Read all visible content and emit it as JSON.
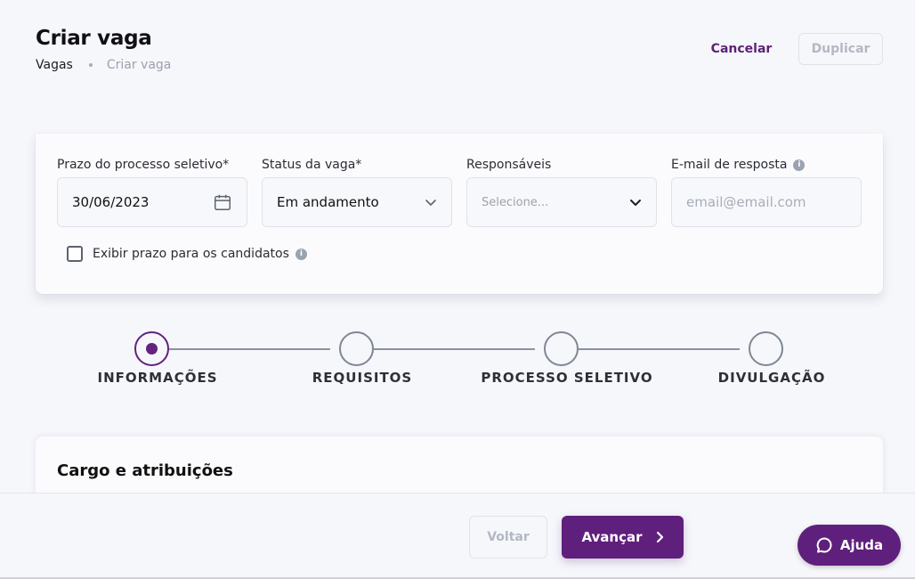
{
  "header": {
    "title": "Criar vaga",
    "breadcrumb": {
      "root": "Vagas",
      "current": "Criar vaga"
    },
    "cancel_label": "Cancelar",
    "duplicate_label": "Duplicar"
  },
  "form": {
    "deadline": {
      "label": "Prazo do processo seletivo*",
      "value": "30/06/2023",
      "icon": "calendar-icon"
    },
    "status": {
      "label": "Status da vaga*",
      "value": "Em andamento",
      "icon": "chevron-down-icon"
    },
    "responsible": {
      "label": "Responsáveis",
      "placeholder": "Selecione...",
      "icon": "chevron-down-icon"
    },
    "email": {
      "label": "E-mail de resposta",
      "placeholder": "email@email.com",
      "icon": "info-icon"
    },
    "show_deadline": {
      "label": "Exibir prazo para os candidatos",
      "checked": false,
      "icon": "info-icon"
    }
  },
  "stepper": {
    "active_index": 0,
    "steps": [
      {
        "label": "INFORMAÇÕES"
      },
      {
        "label": "REQUISITOS"
      },
      {
        "label": "PROCESSO SELETIVO"
      },
      {
        "label": "DIVULGAÇÃO"
      }
    ]
  },
  "section": {
    "title": "Cargo e atribuições"
  },
  "footer": {
    "back_label": "Voltar",
    "next_label": "Avançar",
    "help_label": "Ajuda"
  },
  "colors": {
    "brand": "#5f1f7c",
    "disabled_text": "#b3b8c2"
  }
}
